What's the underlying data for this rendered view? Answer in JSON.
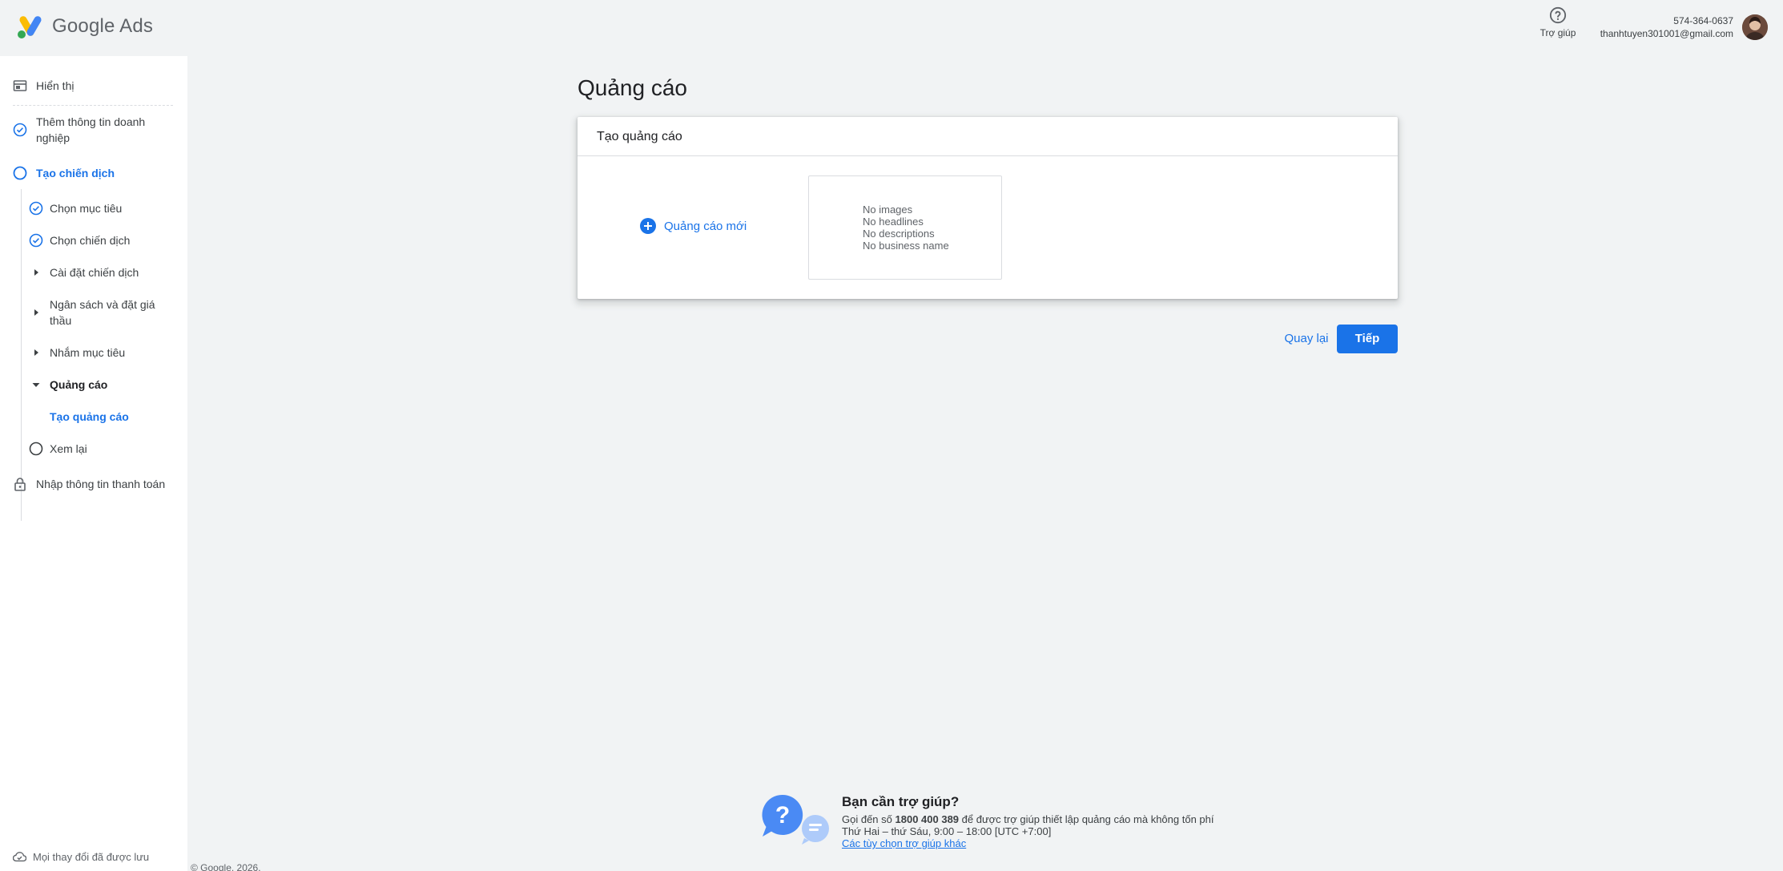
{
  "header": {
    "logo_text": "Google Ads",
    "help_label": "Trợ giúp",
    "phone": "574-364-0637",
    "email": "thanhtuyen301001@gmail.com"
  },
  "sidebar": {
    "items": [
      {
        "label": "Hiển thị",
        "icon": "display-icon",
        "state": "normal"
      },
      {
        "label": "Thêm thông tin doanh nghiệp",
        "icon": "check-circle-icon",
        "state": "done"
      },
      {
        "label": "Tạo chiến dịch",
        "icon": "circle-icon",
        "state": "active"
      },
      {
        "label": "Chọn mục tiêu",
        "icon": "check-circle-icon",
        "state": "done"
      },
      {
        "label": "Chọn chiến dịch",
        "icon": "check-circle-icon",
        "state": "done"
      },
      {
        "label": "Cài đặt chiến dịch",
        "icon": "caret-right-icon",
        "state": "collapsed"
      },
      {
        "label": "Ngân sách và đặt giá thầu",
        "icon": "caret-right-icon",
        "state": "collapsed"
      },
      {
        "label": "Nhắm mục tiêu",
        "icon": "caret-right-icon",
        "state": "collapsed"
      },
      {
        "label": "Quảng cáo",
        "icon": "caret-down-icon",
        "state": "expanded"
      },
      {
        "label": "Tạo quảng cáo",
        "icon": "",
        "state": "current"
      },
      {
        "label": "Xem lại",
        "icon": "circle-icon",
        "state": "pending"
      },
      {
        "label": "Nhập thông tin thanh toán",
        "icon": "lock-icon",
        "state": "locked"
      }
    ],
    "saved_status": "Mọi thay đổi đã được lưu"
  },
  "main": {
    "title": "Quảng cáo",
    "card_title": "Tạo quảng cáo",
    "new_ad_label": "Quảng cáo mới",
    "preview_lines": [
      "No images",
      "No headlines",
      "No descriptions",
      "No business name"
    ],
    "back_label": "Quay lại",
    "next_label": "Tiếp"
  },
  "help": {
    "title": "Bạn cần trợ giúp?",
    "line1_prefix": "Gọi đến số ",
    "phone": "1800 400 389",
    "line1_suffix": " để được trợ giúp thiết lập quảng cáo mà không tốn phí",
    "hours": "Thứ Hai – thứ Sáu, 9:00 – 18:00 [UTC +7:00]",
    "other_options": "Các tùy chọn trợ giúp khác"
  },
  "footer": {
    "copyright": "© Google, 2026."
  },
  "colors": {
    "accent": "#1a73e8",
    "background": "#f1f3f4",
    "text": "#3c4043"
  }
}
